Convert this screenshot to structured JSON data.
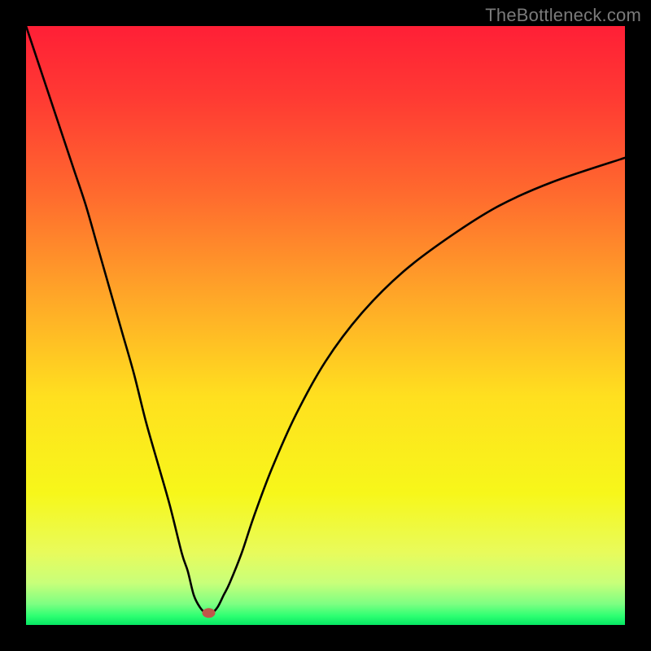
{
  "watermark": "TheBottleneck.com",
  "chart_data": {
    "type": "line",
    "title": "",
    "xlabel": "",
    "ylabel": "",
    "xlim": [
      0,
      100
    ],
    "ylim": [
      0,
      100
    ],
    "grid": false,
    "legend": false,
    "background_gradient": {
      "stops": [
        {
          "offset": 0.0,
          "color": "#ff1f36"
        },
        {
          "offset": 0.12,
          "color": "#ff3a33"
        },
        {
          "offset": 0.28,
          "color": "#ff6a2e"
        },
        {
          "offset": 0.45,
          "color": "#ffa628"
        },
        {
          "offset": 0.62,
          "color": "#ffe01f"
        },
        {
          "offset": 0.78,
          "color": "#f7f71a"
        },
        {
          "offset": 0.88,
          "color": "#e8fb5c"
        },
        {
          "offset": 0.93,
          "color": "#c8ff7a"
        },
        {
          "offset": 0.965,
          "color": "#7dff82"
        },
        {
          "offset": 0.985,
          "color": "#2dff72"
        },
        {
          "offset": 1.0,
          "color": "#06e763"
        }
      ]
    },
    "series": [
      {
        "name": "bottleneck-curve",
        "x": [
          0,
          2,
          4,
          6,
          8,
          10,
          12,
          14,
          16,
          18,
          20,
          22,
          24,
          26,
          27,
          28,
          29,
          30,
          31,
          32,
          33,
          34,
          36,
          38,
          41,
          45,
          50,
          56,
          63,
          71,
          79,
          88,
          100
        ],
        "y": [
          100,
          94,
          88,
          82,
          76,
          70,
          63,
          56,
          49,
          42,
          34,
          27,
          20,
          12,
          9,
          5,
          3,
          2,
          2,
          3,
          5,
          7,
          12,
          18,
          26,
          35,
          44,
          52,
          59,
          65,
          70,
          74,
          78
        ]
      }
    ],
    "marker": {
      "name": "optimal-point",
      "x": 30.5,
      "y": 2.0,
      "color": "#c0564a",
      "rx": 8,
      "ry": 6
    }
  }
}
